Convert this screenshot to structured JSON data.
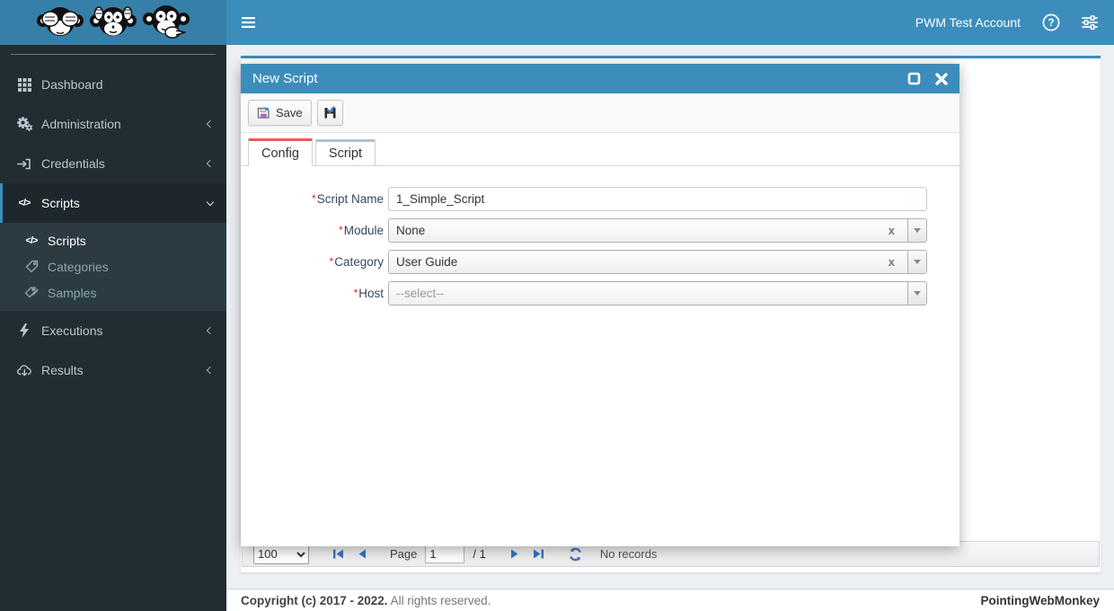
{
  "logo": {
    "monkeys": [
      "see-no-evil-monkey",
      "hear-no-evil-monkey",
      "pointing-monkey"
    ]
  },
  "navbar": {
    "account": "PWM Test Account",
    "icons": [
      "hamburger-icon",
      "help-circle-icon",
      "sliders-icon"
    ]
  },
  "sidebar": {
    "items": [
      {
        "label": "Dashboard",
        "icon": "grid-icon"
      },
      {
        "label": "Administration",
        "icon": "gears-icon",
        "chevron": "left"
      },
      {
        "label": "Credentials",
        "icon": "sign-in-icon",
        "chevron": "left"
      },
      {
        "label": "Scripts",
        "icon": "code-icon",
        "chevron": "down",
        "active": true
      },
      {
        "label": "Executions",
        "icon": "bolt-icon",
        "chevron": "left"
      },
      {
        "label": "Results",
        "icon": "cloud-download-icon",
        "chevron": "left"
      }
    ],
    "submenu": [
      {
        "label": "Scripts",
        "icon": "code-icon",
        "active": true
      },
      {
        "label": "Categories",
        "icon": "tag-icon"
      },
      {
        "label": "Samples",
        "icon": "tags-icon"
      }
    ],
    "code_glyph": "</>"
  },
  "modal": {
    "title": "New Script",
    "toolbar": {
      "save_label": "Save"
    },
    "tabs": [
      {
        "label": "Config",
        "active": true
      },
      {
        "label": "Script"
      }
    ],
    "fields": {
      "script_name": {
        "required": "*",
        "label": "Script Name",
        "value": "1_Simple_Script"
      },
      "module": {
        "required": "*",
        "label": "Module",
        "value": "None",
        "clear": "x"
      },
      "category": {
        "required": "*",
        "label": "Category",
        "value": "User Guide",
        "clear": "x"
      },
      "host": {
        "required": "*",
        "label": "Host",
        "placeholder": "--select--"
      }
    }
  },
  "pager": {
    "page_size": "100",
    "page_label": "Page",
    "current_page": "1",
    "of_pages": "/ 1",
    "status": "No records"
  },
  "footer": {
    "copyright_strong": "Copyright (c) 2017 - 2022.",
    "copyright_rest": " All rights reserved.",
    "brand": "PointingWebMonkey"
  },
  "colors": {
    "navbar_blue": "#3c8dbc",
    "logo_blue": "#367fa9",
    "sidebar_dark": "#222d32",
    "submenu_dark": "#2c3b41",
    "content_bg": "#ecf0f5",
    "tab_active_border": "#f3565d",
    "tab_inactive_border": "#b4bcd8",
    "required_red": "#e02222"
  }
}
